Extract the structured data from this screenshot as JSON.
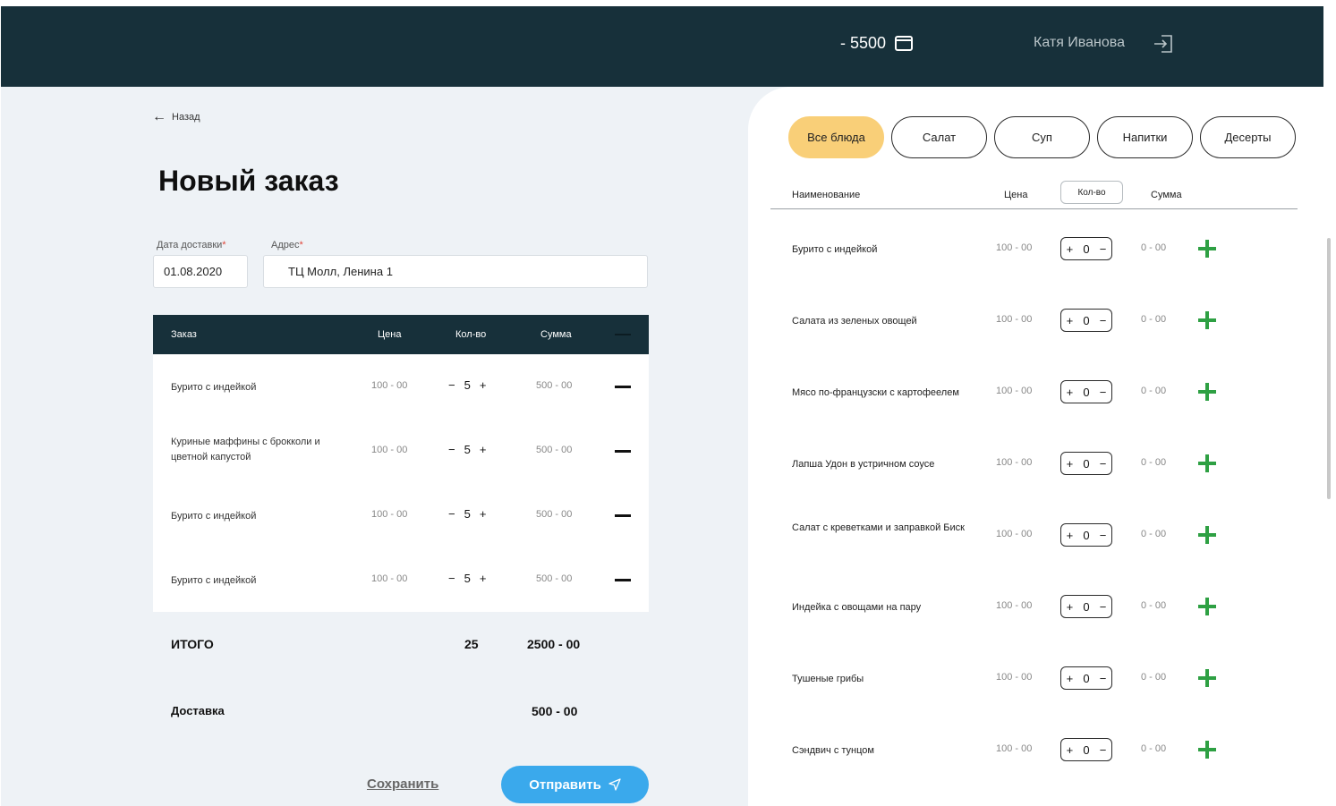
{
  "header": {
    "balance": "- 5500",
    "user_name": "Катя Иванова"
  },
  "order_form": {
    "back_label": "Назад",
    "title": "Новый заказ",
    "delivery_date_label": "Дата доставки",
    "delivery_date_value": "01.08.2020",
    "address_label": "Адрес",
    "address_value": "ТЦ Молл, Ленина 1",
    "required_mark": "*",
    "columns": {
      "order": "Заказ",
      "price": "Цена",
      "qty": "Кол-во",
      "sum": "Сумма"
    },
    "items": [
      {
        "name": "Бурито с индейкой",
        "price": "100 - 00",
        "qty": "5",
        "sum": "500 - 00"
      },
      {
        "name": "Куриные маффины с брокколи и цветной капустой",
        "price": "100 - 00",
        "qty": "5",
        "sum": "500 - 00"
      },
      {
        "name": "Бурито с индейкой",
        "price": "100 - 00",
        "qty": "5",
        "sum": "500 - 00"
      },
      {
        "name": "Бурито с индейкой",
        "price": "100 - 00",
        "qty": "5",
        "sum": "500 - 00"
      }
    ],
    "total_label": "ИТОГО",
    "total_qty": "25",
    "total_sum": "2500 - 00",
    "delivery_label": "Доставка",
    "delivery_sum": "500 - 00",
    "save_label": "Сохранить",
    "send_label": "Отправить"
  },
  "menu": {
    "categories": [
      {
        "label": "Все блюда",
        "active": true
      },
      {
        "label": "Салат",
        "active": false
      },
      {
        "label": "Суп",
        "active": false
      },
      {
        "label": "Напитки",
        "active": false
      },
      {
        "label": "Десерты",
        "active": false
      }
    ],
    "columns": {
      "name": "Наименование",
      "price": "Цена",
      "qty": "Кол-во",
      "sum": "Сумма"
    },
    "items": [
      {
        "name": "Бурито с индейкой",
        "price": "100 - 00",
        "qty": "0",
        "sum": "0 - 00"
      },
      {
        "name": "Салата из зеленых овощей",
        "price": "100 - 00",
        "qty": "0",
        "sum": "0 - 00"
      },
      {
        "name": "Мясо по-французски с картофеелем",
        "price": "100 - 00",
        "qty": "0",
        "sum": "0 - 00"
      },
      {
        "name": "Лапша Удон в устричном соусе",
        "price": "100 - 00",
        "qty": "0",
        "sum": "0 - 00"
      },
      {
        "name": "Салат с креветками и заправкой Биск",
        "price": "100 - 00",
        "qty": "0",
        "sum": "0 - 00"
      },
      {
        "name": "Индейка с овощами на пару",
        "price": "100 - 00",
        "qty": "0",
        "sum": "0 - 00"
      },
      {
        "name": "Тушеные грибы",
        "price": "100 - 00",
        "qty": "0",
        "sum": "0 - 00"
      },
      {
        "name": "Сэндвич с тунцом",
        "price": "100 - 00",
        "qty": "0",
        "sum": "0 - 00"
      }
    ]
  }
}
